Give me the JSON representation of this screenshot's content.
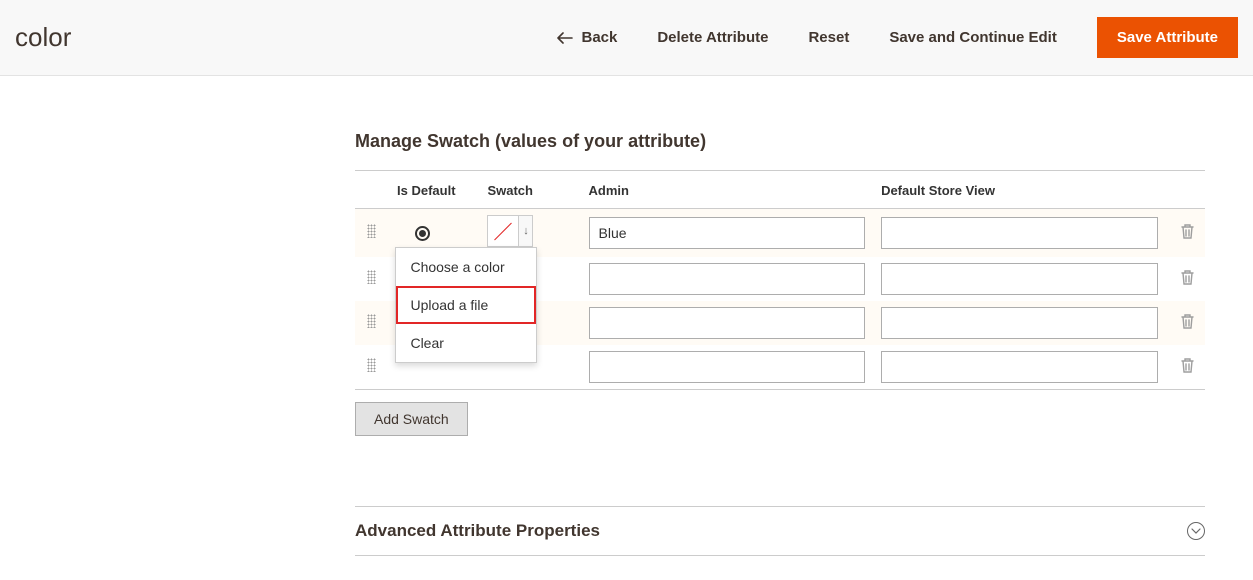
{
  "header": {
    "title": "color",
    "back": "Back",
    "delete": "Delete Attribute",
    "reset": "Reset",
    "save_continue": "Save and Continue Edit",
    "save": "Save Attribute"
  },
  "swatch_section": {
    "title": "Manage Swatch (values of your attribute)",
    "columns": {
      "is_default": "Is Default",
      "swatch": "Swatch",
      "admin": "Admin",
      "store_view": "Default Store View"
    },
    "rows": [
      {
        "is_default": true,
        "admin": "Blue",
        "store_view": ""
      },
      {
        "is_default": false,
        "admin": "",
        "store_view": ""
      },
      {
        "is_default": false,
        "admin": "",
        "store_view": ""
      },
      {
        "is_default": false,
        "admin": "",
        "store_view": ""
      }
    ],
    "dropdown": {
      "choose_color": "Choose a color",
      "upload_file": "Upload a file",
      "clear": "Clear"
    },
    "add_swatch": "Add Swatch"
  },
  "advanced": {
    "title": "Advanced Attribute Properties"
  }
}
